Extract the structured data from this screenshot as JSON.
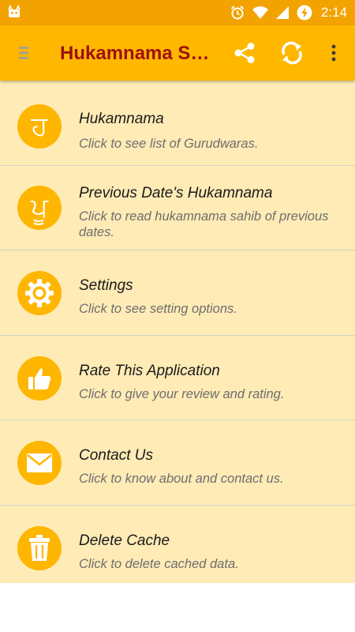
{
  "status_bar": {
    "time": "2:14"
  },
  "app_bar": {
    "title": "Hukamnama Sahib"
  },
  "menu_items": [
    {
      "title": "Hukamnama",
      "subtitle": "Click to see list of Gurudwaras.",
      "glyph": "ਹ",
      "icon": "gurmukhi-ha-icon"
    },
    {
      "title": "Previous Date's Hukamnama",
      "subtitle": "Click to read hukamnama sahib of previous dates.",
      "glyph": "ਪੂ",
      "icon": "gurmukhi-pu-icon"
    },
    {
      "title": "Settings",
      "subtitle": "Click to see setting options.",
      "icon": "gear-icon"
    },
    {
      "title": "Rate This Application",
      "subtitle": "Click to give your review and rating.",
      "icon": "thumbs-up-icon"
    },
    {
      "title": "Contact Us",
      "subtitle": "Click to know about and contact us.",
      "icon": "envelope-icon"
    },
    {
      "title": "Delete Cache",
      "subtitle": "Click to delete cached data.",
      "icon": "trash-icon"
    }
  ],
  "colors": {
    "status_bar": "#f2a300",
    "app_bar": "#ffb700",
    "title": "#9e1010",
    "list_bg": "#ffebb6",
    "icon_circle": "#ffb600"
  }
}
